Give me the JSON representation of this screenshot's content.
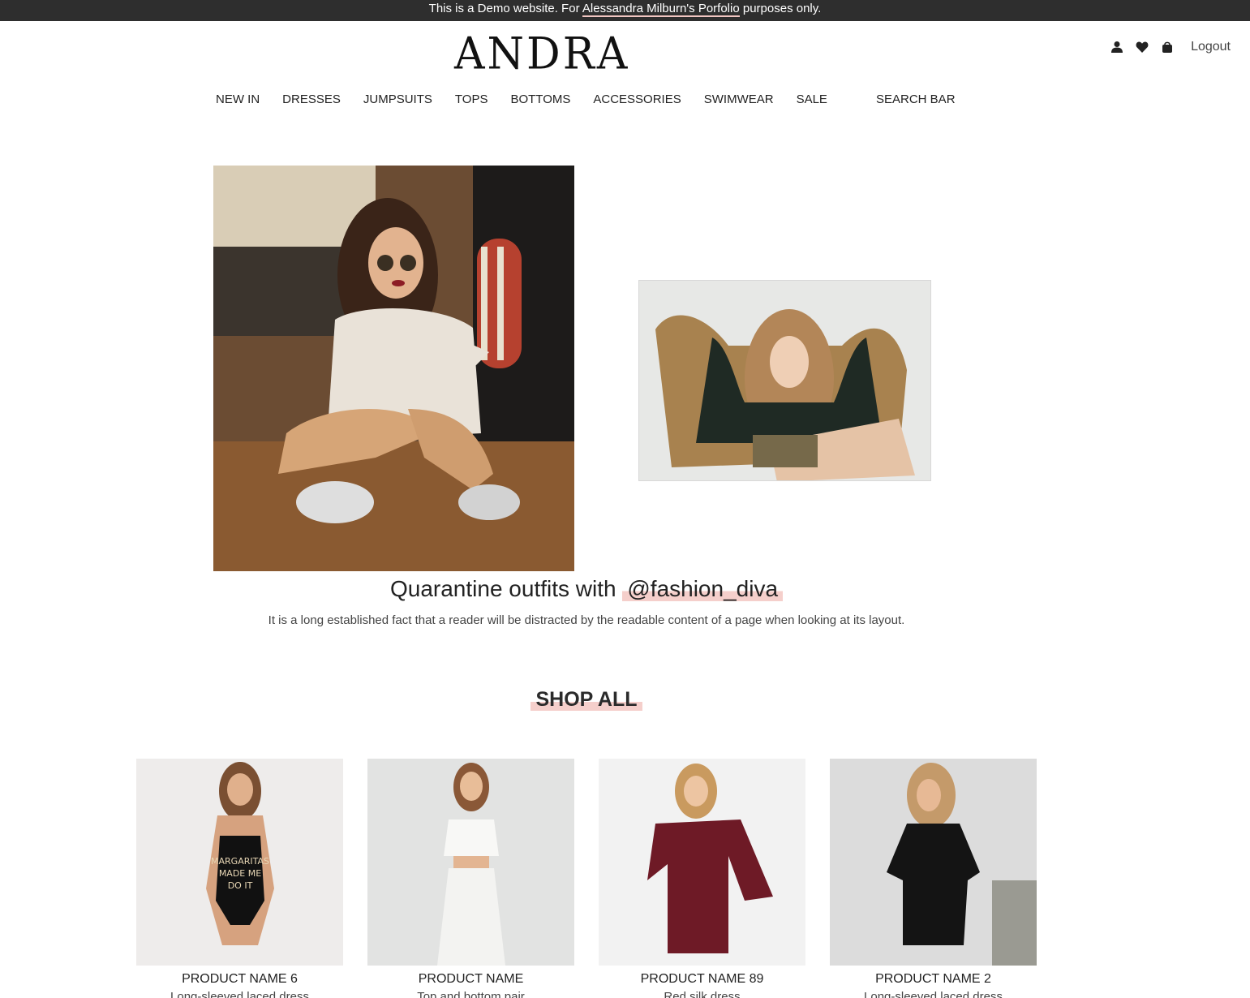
{
  "demo_banner": {
    "prefix": "This is a Demo website. For",
    "link": "Alessandra Milburn's Porfolio",
    "suffix": "purposes only."
  },
  "header": {
    "logo": "ANDRA",
    "logout": "Logout",
    "icons": [
      "user-icon",
      "heart-icon",
      "shopping-bag-icon"
    ]
  },
  "nav": {
    "items": [
      "NEW IN",
      "DRESSES",
      "JUMPSUITS",
      "TOPS",
      "BOTTOMS",
      "ACCESSORIES",
      "SWIMWEAR",
      "SALE"
    ],
    "search": "SEARCH BAR"
  },
  "post": {
    "title_prefix": "Quarantine outfits with",
    "title_handle": "@fashion_diva",
    "description": "It is a long established fact that a reader will be distracted by the readable content of a page when looking at its layout."
  },
  "shop": {
    "heading": "SHOP ALL",
    "products": [
      {
        "name": "PRODUCT NAME 6",
        "description": "Long-sleeved laced dress",
        "image_text": [
          "MARGARITAS",
          "MADE ME",
          "DO IT"
        ]
      },
      {
        "name": "PRODUCT NAME",
        "description": "Top and bottom pair"
      },
      {
        "name": "PRODUCT NAME 89",
        "description": "Red silk dress"
      },
      {
        "name": "PRODUCT NAME 2",
        "description": "Long-sleeved laced dress"
      }
    ]
  },
  "colors": {
    "banner_bg": "#2e2e2e",
    "accent_highlight": "#f5cfcb",
    "text": "#2b2b2b"
  }
}
